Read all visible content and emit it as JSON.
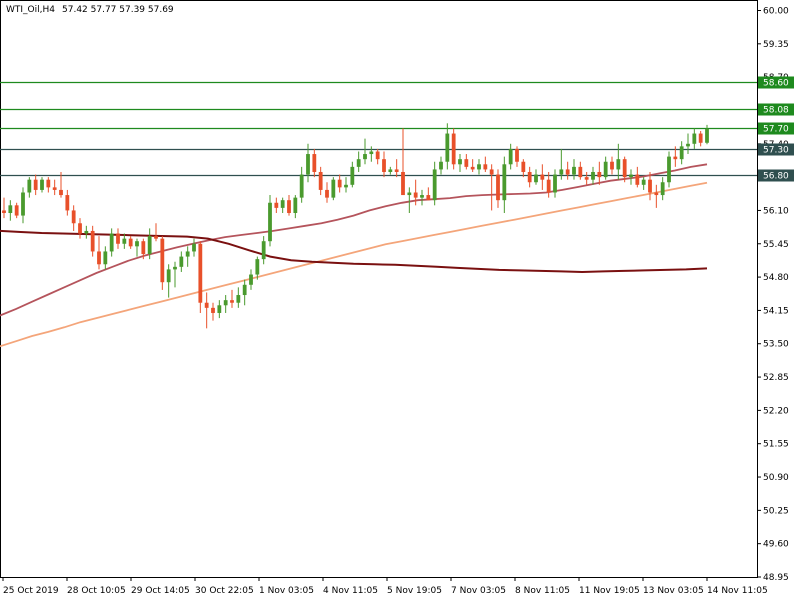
{
  "header": {
    "symbol": "WTI_Oil,H4",
    "ohlc": "57.42 57.77 57.39 57.69"
  },
  "colors": {
    "bull": "#4a9a2e",
    "bear": "#e8502a",
    "level_green": "#1e8a1e",
    "level_dark": "#2f4f4f",
    "ma_fast": "#b5545c",
    "ma_mid": "#f4a57a",
    "ma_slow": "#7a1010",
    "axis": "#000000"
  },
  "chart_data": {
    "type": "candlestick",
    "y_range": [
      48.95,
      60.0
    ],
    "y_ticks": [
      "60.00",
      "59.35",
      "58.70",
      "58.05",
      "57.40",
      "56.75",
      "56.10",
      "55.45",
      "54.80",
      "54.15",
      "53.50",
      "52.85",
      "52.20",
      "51.55",
      "50.90",
      "50.25",
      "49.60",
      "48.95"
    ],
    "x_ticks": [
      "25 Oct 2019",
      "28 Oct 10:05",
      "29 Oct 14:05",
      "30 Oct 22:05",
      "1 Nov 03:05",
      "4 Nov 11:05",
      "5 Nov 19:05",
      "7 Nov 03:05",
      "8 Nov 11:05",
      "11 Nov 19:05",
      "13 Nov 03:05",
      "14 Nov 11:05"
    ],
    "levels": [
      {
        "value": 58.6,
        "label": "58.60",
        "color": "green"
      },
      {
        "value": 58.08,
        "label": "58.08",
        "color": "green"
      },
      {
        "value": 57.7,
        "label": "57.70",
        "color": "green"
      },
      {
        "value": 57.3,
        "label": "57.30",
        "color": "dark"
      },
      {
        "value": 56.8,
        "label": "56.80",
        "color": "dark"
      }
    ],
    "candles": [
      {
        "o": 56.1,
        "h": 56.35,
        "l": 55.95,
        "c": 56.05
      },
      {
        "o": 56.05,
        "h": 56.3,
        "l": 55.9,
        "c": 56.2
      },
      {
        "o": 56.2,
        "h": 56.25,
        "l": 55.95,
        "c": 56.0
      },
      {
        "o": 56.0,
        "h": 56.55,
        "l": 55.85,
        "c": 56.45
      },
      {
        "o": 56.45,
        "h": 56.75,
        "l": 56.35,
        "c": 56.7
      },
      {
        "o": 56.7,
        "h": 56.8,
        "l": 56.4,
        "c": 56.5
      },
      {
        "o": 56.5,
        "h": 56.75,
        "l": 56.45,
        "c": 56.7
      },
      {
        "o": 56.7,
        "h": 56.75,
        "l": 56.45,
        "c": 56.55
      },
      {
        "o": 56.55,
        "h": 56.7,
        "l": 56.4,
        "c": 56.5
      },
      {
        "o": 56.5,
        "h": 56.85,
        "l": 56.35,
        "c": 56.4
      },
      {
        "o": 56.4,
        "h": 56.5,
        "l": 56.0,
        "c": 56.1
      },
      {
        "o": 56.1,
        "h": 56.2,
        "l": 55.7,
        "c": 55.85
      },
      {
        "o": 55.85,
        "h": 55.95,
        "l": 55.55,
        "c": 55.65
      },
      {
        "o": 55.65,
        "h": 55.8,
        "l": 55.55,
        "c": 55.7
      },
      {
        "o": 55.7,
        "h": 55.8,
        "l": 55.2,
        "c": 55.3
      },
      {
        "o": 55.3,
        "h": 55.6,
        "l": 54.95,
        "c": 55.05
      },
      {
        "o": 55.05,
        "h": 55.4,
        "l": 54.95,
        "c": 55.3
      },
      {
        "o": 55.3,
        "h": 55.75,
        "l": 55.2,
        "c": 55.65
      },
      {
        "o": 55.65,
        "h": 55.75,
        "l": 55.35,
        "c": 55.45
      },
      {
        "o": 55.45,
        "h": 55.65,
        "l": 55.35,
        "c": 55.55
      },
      {
        "o": 55.55,
        "h": 55.6,
        "l": 55.35,
        "c": 55.4
      },
      {
        "o": 55.4,
        "h": 55.55,
        "l": 55.2,
        "c": 55.5
      },
      {
        "o": 55.5,
        "h": 55.55,
        "l": 55.15,
        "c": 55.25
      },
      {
        "o": 55.25,
        "h": 55.75,
        "l": 55.15,
        "c": 55.6
      },
      {
        "o": 55.6,
        "h": 55.85,
        "l": 55.5,
        "c": 55.55
      },
      {
        "o": 55.55,
        "h": 55.6,
        "l": 54.55,
        "c": 54.7
      },
      {
        "o": 54.7,
        "h": 55.05,
        "l": 54.4,
        "c": 54.95
      },
      {
        "o": 54.95,
        "h": 55.1,
        "l": 54.6,
        "c": 55.0
      },
      {
        "o": 55.0,
        "h": 55.3,
        "l": 54.9,
        "c": 55.2
      },
      {
        "o": 55.2,
        "h": 55.4,
        "l": 55.0,
        "c": 55.3
      },
      {
        "o": 55.3,
        "h": 55.55,
        "l": 55.2,
        "c": 55.45
      },
      {
        "o": 55.45,
        "h": 55.5,
        "l": 54.1,
        "c": 54.3
      },
      {
        "o": 54.3,
        "h": 54.5,
        "l": 53.8,
        "c": 54.2
      },
      {
        "o": 54.2,
        "h": 54.3,
        "l": 53.95,
        "c": 54.1
      },
      {
        "o": 54.1,
        "h": 54.35,
        "l": 54.0,
        "c": 54.25
      },
      {
        "o": 54.25,
        "h": 54.45,
        "l": 54.1,
        "c": 54.35
      },
      {
        "o": 54.35,
        "h": 54.55,
        "l": 54.2,
        "c": 54.3
      },
      {
        "o": 54.3,
        "h": 54.6,
        "l": 54.2,
        "c": 54.45
      },
      {
        "o": 54.45,
        "h": 54.75,
        "l": 54.25,
        "c": 54.65
      },
      {
        "o": 54.65,
        "h": 54.95,
        "l": 54.55,
        "c": 54.85
      },
      {
        "o": 54.85,
        "h": 55.2,
        "l": 54.75,
        "c": 55.15
      },
      {
        "o": 55.15,
        "h": 55.6,
        "l": 55.05,
        "c": 55.5
      },
      {
        "o": 55.5,
        "h": 56.4,
        "l": 55.4,
        "c": 56.25
      },
      {
        "o": 56.25,
        "h": 56.35,
        "l": 56.05,
        "c": 56.15
      },
      {
        "o": 56.15,
        "h": 56.35,
        "l": 56.05,
        "c": 56.3
      },
      {
        "o": 56.3,
        "h": 56.4,
        "l": 56.0,
        "c": 56.05
      },
      {
        "o": 56.05,
        "h": 56.4,
        "l": 55.95,
        "c": 56.35
      },
      {
        "o": 56.35,
        "h": 56.95,
        "l": 56.25,
        "c": 56.8
      },
      {
        "o": 56.8,
        "h": 57.4,
        "l": 56.65,
        "c": 57.2
      },
      {
        "o": 57.2,
        "h": 57.3,
        "l": 56.75,
        "c": 56.85
      },
      {
        "o": 56.85,
        "h": 56.95,
        "l": 56.4,
        "c": 56.5
      },
      {
        "o": 56.5,
        "h": 56.65,
        "l": 56.25,
        "c": 56.35
      },
      {
        "o": 56.35,
        "h": 56.75,
        "l": 56.3,
        "c": 56.7
      },
      {
        "o": 56.7,
        "h": 56.8,
        "l": 56.45,
        "c": 56.55
      },
      {
        "o": 56.55,
        "h": 56.75,
        "l": 56.45,
        "c": 56.6
      },
      {
        "o": 56.6,
        "h": 57.05,
        "l": 56.55,
        "c": 56.95
      },
      {
        "o": 56.95,
        "h": 57.25,
        "l": 56.85,
        "c": 57.1
      },
      {
        "o": 57.1,
        "h": 57.5,
        "l": 57.0,
        "c": 57.2
      },
      {
        "o": 57.2,
        "h": 57.35,
        "l": 57.05,
        "c": 57.25
      },
      {
        "o": 57.25,
        "h": 57.3,
        "l": 57.0,
        "c": 57.1
      },
      {
        "o": 57.1,
        "h": 57.25,
        "l": 56.75,
        "c": 56.85
      },
      {
        "o": 56.85,
        "h": 56.95,
        "l": 56.8,
        "c": 56.9
      },
      {
        "o": 56.9,
        "h": 57.1,
        "l": 56.75,
        "c": 56.85
      },
      {
        "o": 56.85,
        "h": 57.7,
        "l": 56.4,
        "c": 56.4
      },
      {
        "o": 56.4,
        "h": 56.55,
        "l": 56.05,
        "c": 56.45
      },
      {
        "o": 56.45,
        "h": 56.7,
        "l": 56.2,
        "c": 56.35
      },
      {
        "o": 56.35,
        "h": 56.5,
        "l": 56.2,
        "c": 56.4
      },
      {
        "o": 56.4,
        "h": 56.55,
        "l": 56.3,
        "c": 56.3
      },
      {
        "o": 56.3,
        "h": 57.05,
        "l": 56.2,
        "c": 56.9
      },
      {
        "o": 56.9,
        "h": 57.15,
        "l": 56.8,
        "c": 57.05
      },
      {
        "o": 57.05,
        "h": 57.8,
        "l": 56.9,
        "c": 57.6
      },
      {
        "o": 57.6,
        "h": 57.7,
        "l": 56.9,
        "c": 57.0
      },
      {
        "o": 57.0,
        "h": 57.2,
        "l": 56.85,
        "c": 57.1
      },
      {
        "o": 57.1,
        "h": 57.2,
        "l": 56.9,
        "c": 56.95
      },
      {
        "o": 56.95,
        "h": 57.1,
        "l": 56.85,
        "c": 56.9
      },
      {
        "o": 56.9,
        "h": 57.1,
        "l": 56.8,
        "c": 57.0
      },
      {
        "o": 57.0,
        "h": 57.15,
        "l": 56.85,
        "c": 56.9
      },
      {
        "o": 56.9,
        "h": 57.0,
        "l": 56.1,
        "c": 56.8
      },
      {
        "o": 56.8,
        "h": 56.9,
        "l": 56.15,
        "c": 56.3
      },
      {
        "o": 56.3,
        "h": 57.15,
        "l": 56.05,
        "c": 57.0
      },
      {
        "o": 57.0,
        "h": 57.4,
        "l": 56.9,
        "c": 57.3
      },
      {
        "o": 57.3,
        "h": 57.35,
        "l": 56.95,
        "c": 57.05
      },
      {
        "o": 57.05,
        "h": 57.1,
        "l": 56.75,
        "c": 56.85
      },
      {
        "o": 56.85,
        "h": 56.95,
        "l": 56.55,
        "c": 56.65
      },
      {
        "o": 56.65,
        "h": 56.9,
        "l": 56.6,
        "c": 56.8
      },
      {
        "o": 56.8,
        "h": 57.0,
        "l": 56.5,
        "c": 56.7
      },
      {
        "o": 56.7,
        "h": 56.85,
        "l": 56.35,
        "c": 56.45
      },
      {
        "o": 56.45,
        "h": 56.9,
        "l": 56.35,
        "c": 56.8
      },
      {
        "o": 56.8,
        "h": 57.3,
        "l": 56.7,
        "c": 56.9
      },
      {
        "o": 56.9,
        "h": 57.05,
        "l": 56.7,
        "c": 56.8
      },
      {
        "o": 56.8,
        "h": 57.1,
        "l": 56.7,
        "c": 56.95
      },
      {
        "o": 56.95,
        "h": 57.05,
        "l": 56.7,
        "c": 56.75
      },
      {
        "o": 56.75,
        "h": 56.85,
        "l": 56.6,
        "c": 56.7
      },
      {
        "o": 56.7,
        "h": 56.95,
        "l": 56.6,
        "c": 56.85
      },
      {
        "o": 56.85,
        "h": 57.05,
        "l": 56.6,
        "c": 56.75
      },
      {
        "o": 56.75,
        "h": 57.15,
        "l": 56.7,
        "c": 57.05
      },
      {
        "o": 57.05,
        "h": 57.15,
        "l": 56.8,
        "c": 56.9
      },
      {
        "o": 56.9,
        "h": 57.4,
        "l": 56.7,
        "c": 57.1
      },
      {
        "o": 57.1,
        "h": 57.15,
        "l": 56.65,
        "c": 56.75
      },
      {
        "o": 56.75,
        "h": 56.9,
        "l": 56.6,
        "c": 56.8
      },
      {
        "o": 56.8,
        "h": 56.95,
        "l": 56.55,
        "c": 56.6
      },
      {
        "o": 56.6,
        "h": 56.75,
        "l": 56.5,
        "c": 56.7
      },
      {
        "o": 56.7,
        "h": 56.85,
        "l": 56.3,
        "c": 56.45
      },
      {
        "o": 56.45,
        "h": 56.6,
        "l": 56.15,
        "c": 56.4
      },
      {
        "o": 56.4,
        "h": 56.75,
        "l": 56.3,
        "c": 56.65
      },
      {
        "o": 56.65,
        "h": 57.25,
        "l": 56.55,
        "c": 57.15
      },
      {
        "o": 57.15,
        "h": 57.35,
        "l": 56.95,
        "c": 57.1
      },
      {
        "o": 57.1,
        "h": 57.45,
        "l": 57.0,
        "c": 57.35
      },
      {
        "o": 57.35,
        "h": 57.6,
        "l": 57.2,
        "c": 57.4
      },
      {
        "o": 57.4,
        "h": 57.7,
        "l": 57.3,
        "c": 57.6
      },
      {
        "o": 57.6,
        "h": 57.65,
        "l": 57.35,
        "c": 57.42
      },
      {
        "o": 57.42,
        "h": 57.77,
        "l": 57.39,
        "c": 57.69
      }
    ],
    "ma_fast": [
      54.05,
      54.18,
      54.32,
      54.46,
      54.6,
      54.74,
      54.88,
      55.0,
      55.12,
      55.22,
      55.3,
      55.38,
      55.45,
      55.52,
      55.58,
      55.62,
      55.66,
      55.7,
      55.75,
      55.8,
      55.85,
      55.92,
      56.0,
      56.1,
      56.18,
      56.25,
      56.3,
      56.32,
      56.34,
      56.38,
      56.4,
      56.41,
      56.42,
      56.43,
      56.45,
      56.5,
      56.56,
      56.62,
      56.68,
      56.72,
      56.76,
      56.82,
      56.88,
      56.95,
      57.0
    ],
    "ma_mid": [
      53.45,
      53.55,
      53.65,
      53.73,
      53.82,
      53.92,
      54.0,
      54.08,
      54.16,
      54.24,
      54.32,
      54.4,
      54.48,
      54.56,
      54.64,
      54.72,
      54.8,
      54.88,
      54.96,
      55.04,
      55.12,
      55.2,
      55.28,
      55.36,
      55.44,
      55.5,
      55.56,
      55.62,
      55.68,
      55.74,
      55.8,
      55.86,
      55.92,
      55.98,
      56.04,
      56.1,
      56.16,
      56.22,
      56.28,
      56.34,
      56.4,
      56.46,
      56.52,
      56.58,
      56.64
    ],
    "ma_slow": [
      55.7,
      55.68,
      55.66,
      55.65,
      55.64,
      55.63,
      55.62,
      55.61,
      55.6,
      55.59,
      55.55,
      55.45,
      55.32,
      55.2,
      55.13,
      55.1,
      55.08,
      55.06,
      55.05,
      55.04,
      55.02,
      55.0,
      54.98,
      54.96,
      54.94,
      54.93,
      54.92,
      54.91,
      54.9,
      54.91,
      54.92,
      54.93,
      54.94,
      54.95,
      54.97
    ]
  }
}
